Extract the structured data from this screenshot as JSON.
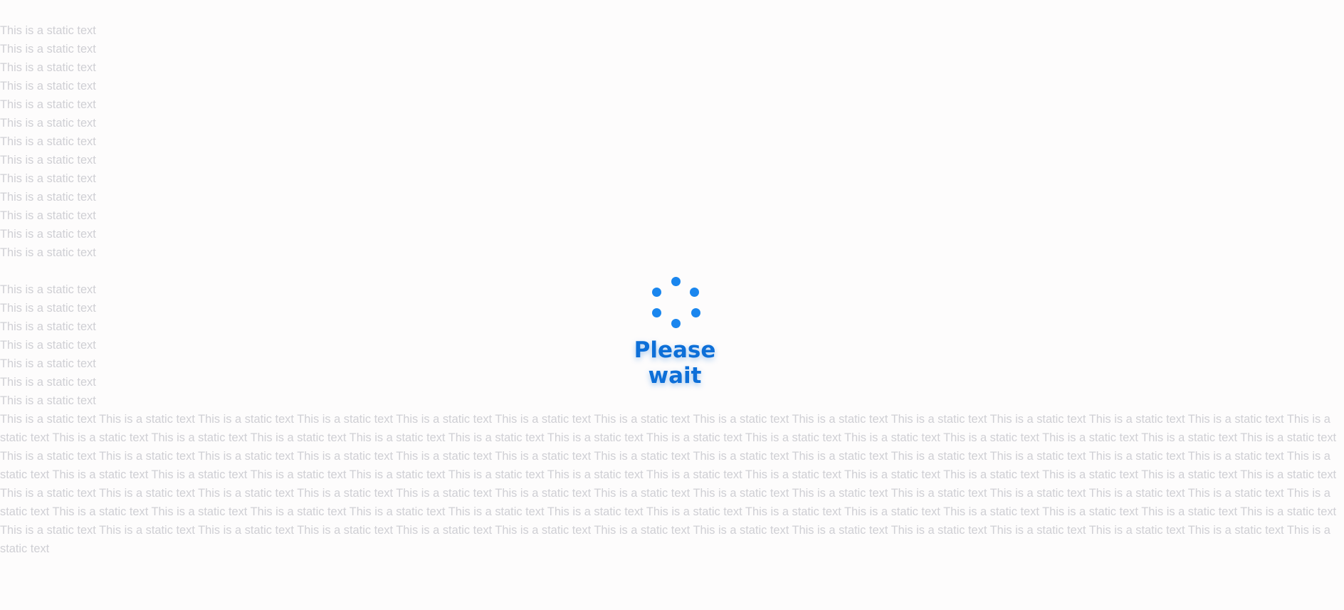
{
  "background": {
    "text_color": "#c9c9cf",
    "page_color": "#fdfcfc",
    "line_text": "This is a static text",
    "first_block_lines": 13,
    "second_block_lines": 8,
    "trailing_paragraph_repeats": 95
  },
  "loader": {
    "message": "Please wait",
    "spinner_icon": "loading-dots-icon",
    "accent_color": "#1a86ee"
  }
}
